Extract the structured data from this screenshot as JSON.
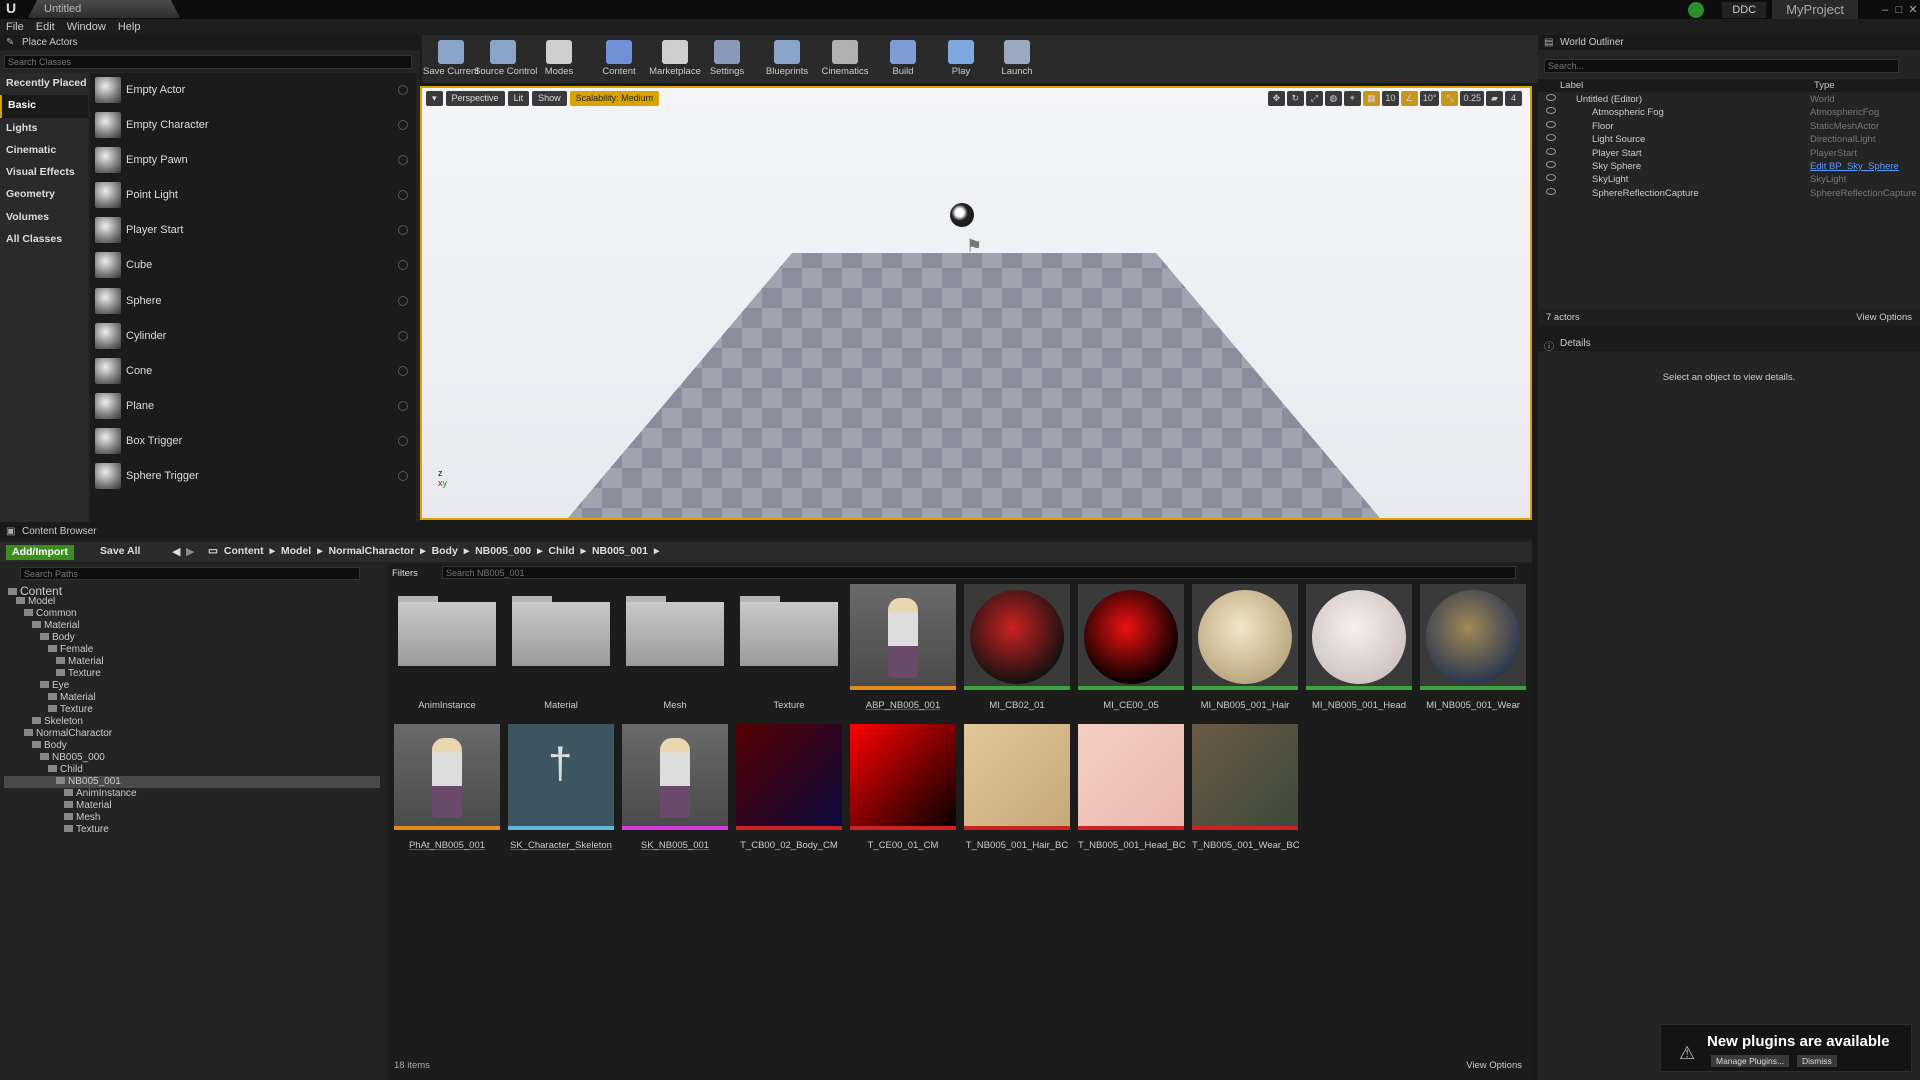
{
  "window": {
    "title": "Untitled",
    "ddc": "DDC",
    "project": "MyProject"
  },
  "menu": [
    "File",
    "Edit",
    "Window",
    "Help"
  ],
  "place_actors": {
    "tab": "Place Actors",
    "search_placeholder": "Search Classes",
    "categories": [
      "Recently Placed",
      "Basic",
      "Lights",
      "Cinematic",
      "Visual Effects",
      "Geometry",
      "Volumes",
      "All Classes"
    ],
    "selected_category": "Basic",
    "items": [
      "Empty Actor",
      "Empty Character",
      "Empty Pawn",
      "Point Light",
      "Player Start",
      "Cube",
      "Sphere",
      "Cylinder",
      "Cone",
      "Plane",
      "Box Trigger",
      "Sphere Trigger"
    ]
  },
  "toolbar": [
    "Save Current",
    "Source Control",
    "Modes",
    "Content",
    "Marketplace",
    "Settings",
    "Blueprints",
    "Cinematics",
    "Build",
    "Play",
    "Launch"
  ],
  "viewport": {
    "perspective": "Perspective",
    "lit": "Lit",
    "show": "Show",
    "scalability": "Scalability: Medium",
    "grid": "10",
    "rot": "10°",
    "scale": "0.25",
    "speed": "4"
  },
  "outliner": {
    "tab": "World Outliner",
    "search_placeholder": "Search...",
    "col_label": "Label",
    "col_type": "Type",
    "rows": [
      {
        "label": "Untitled (Editor)",
        "type": "World"
      },
      {
        "label": "Atmospheric Fog",
        "type": "AtmosphericFog"
      },
      {
        "label": "Floor",
        "type": "StaticMeshActor"
      },
      {
        "label": "Light Source",
        "type": "DirectionalLight"
      },
      {
        "label": "Player Start",
        "type": "PlayerStart"
      },
      {
        "label": "Sky Sphere",
        "type": "Edit BP_Sky_Sphere"
      },
      {
        "label": "SkyLight",
        "type": "SkyLight"
      },
      {
        "label": "SphereReflectionCapture",
        "type": "SphereReflectionCapture"
      }
    ],
    "count": "7 actors",
    "view_options": "View Options"
  },
  "details": {
    "tab": "Details",
    "empty": "Select an object to view details."
  },
  "content_browser": {
    "tab": "Content Browser",
    "add_import": "Add/Import",
    "save_all": "Save All",
    "breadcrumb": [
      "Content",
      "Model",
      "NormalCharactor",
      "Body",
      "NB005_000",
      "Child",
      "NB005_001"
    ],
    "search_paths": "Search Paths",
    "filters": "Filters",
    "search_assets": "Search NB005_001",
    "tree": [
      {
        "label": "Content",
        "d": 0
      },
      {
        "label": "Model",
        "d": 1
      },
      {
        "label": "Common",
        "d": 2
      },
      {
        "label": "Material",
        "d": 3
      },
      {
        "label": "Body",
        "d": 4
      },
      {
        "label": "Female",
        "d": 5
      },
      {
        "label": "Material",
        "d": 6
      },
      {
        "label": "Texture",
        "d": 6
      },
      {
        "label": "Eye",
        "d": 4
      },
      {
        "label": "Material",
        "d": 5
      },
      {
        "label": "Texture",
        "d": 5
      },
      {
        "label": "Skeleton",
        "d": 3
      },
      {
        "label": "NormalCharactor",
        "d": 2
      },
      {
        "label": "Body",
        "d": 3
      },
      {
        "label": "NB005_000",
        "d": 4
      },
      {
        "label": "Child",
        "d": 5
      },
      {
        "label": "NB005_001",
        "d": 6
      },
      {
        "label": "AnimInstance",
        "d": 7
      },
      {
        "label": "Material",
        "d": 7
      },
      {
        "label": "Mesh",
        "d": 7
      },
      {
        "label": "Texture",
        "d": 7
      }
    ],
    "selected_tree": "NB005_001",
    "assets": [
      {
        "name": "AnimInstance",
        "kind": "folder",
        "bar": ""
      },
      {
        "name": "Material",
        "kind": "folder",
        "bar": ""
      },
      {
        "name": "Mesh",
        "kind": "folder",
        "bar": ""
      },
      {
        "name": "Texture",
        "kind": "folder",
        "bar": ""
      },
      {
        "name": "ABP_NB005_001",
        "kind": "char",
        "bar": "#e08a1e"
      },
      {
        "name": "MI_CB02_01",
        "kind": "ball",
        "c1": "#c22",
        "c2": "#111",
        "bar": "#3aa33a"
      },
      {
        "name": "MI_CE00_05",
        "kind": "ball",
        "c1": "#e11",
        "c2": "#000",
        "bar": "#3aa33a"
      },
      {
        "name": "MI_NB005_001_Hair",
        "kind": "ball",
        "c1": "#f2e6c8",
        "c2": "#b9a67e",
        "bar": "#3aa33a"
      },
      {
        "name": "MI_NB005_001_Head",
        "kind": "ball",
        "c1": "#f4f0ee",
        "c2": "#cfc3c0",
        "bar": "#3aa33a"
      },
      {
        "name": "MI_NB005_001_Wear",
        "kind": "ball",
        "c1": "#a08a56",
        "c2": "#2a3550",
        "bar": "#3aa33a"
      },
      {
        "name": "PhAt_NB005_001",
        "kind": "char",
        "bar": "#e08a1e"
      },
      {
        "name": "SK_Character_Skeleton",
        "kind": "skel",
        "bar": "#64b4d8"
      },
      {
        "name": "SK_NB005_001",
        "kind": "char",
        "bar": "#d63be0"
      },
      {
        "name": "T_CB00_02_Body_CM",
        "kind": "tex",
        "c1": "#500",
        "c2": "#0a0a40",
        "bar": "#cc2222"
      },
      {
        "name": "T_CE00_01_CM",
        "kind": "tex",
        "c1": "#f00",
        "c2": "#000",
        "bar": "#cc2222"
      },
      {
        "name": "T_NB005_001_Hair_BC",
        "kind": "tex",
        "c1": "#e2c79a",
        "c2": "#c6a878",
        "bar": "#cc2222"
      },
      {
        "name": "T_NB005_001_Head_BC",
        "kind": "tex",
        "c1": "#f4cfc4",
        "c2": "#e9b8ad",
        "bar": "#cc2222"
      },
      {
        "name": "T_NB005_001_Wear_BC",
        "kind": "tex",
        "c1": "#6d5a48",
        "c2": "#3a4a3a",
        "bar": "#cc2222"
      }
    ],
    "item_count": "18 items",
    "view_options": "View Options"
  },
  "toast": {
    "message": "New plugins are available",
    "manage": "Manage Plugins...",
    "dismiss": "Dismiss"
  }
}
